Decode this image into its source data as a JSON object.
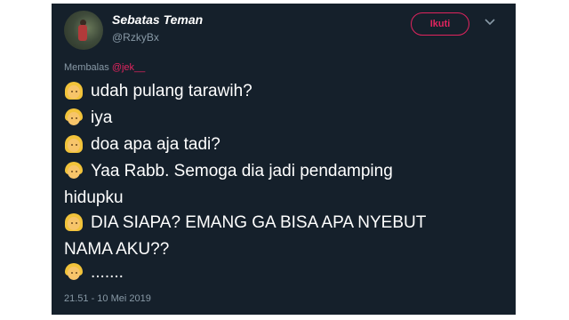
{
  "tweet": {
    "display_name": "Sebatas Teman",
    "handle": "@RzkyBx",
    "follow_label": "Ikuti",
    "reply_prefix": "Membalas",
    "reply_mention": "@jek__",
    "lines": [
      {
        "emoji": "girl-emoji",
        "text": "udah pulang tarawih?"
      },
      {
        "emoji": "boy-emoji",
        "text": "iya"
      },
      {
        "emoji": "girl-emoji",
        "text": "doa apa aja tadi?"
      },
      {
        "emoji": "boy-emoji",
        "text": "Yaa Rabb. Semoga dia jadi pendamping"
      },
      {
        "emoji": "girl-emoji",
        "text": "DIA SIAPA? EMANG GA BISA APA NYEBUT"
      },
      {
        "emoji": "boy-emoji",
        "text": "......."
      }
    ],
    "continuations": [
      "hidupku",
      "NAMA AKU??"
    ],
    "timestamp": "21.51 - 10 Mei 2019"
  },
  "colors": {
    "background": "#15202b",
    "accent": "#e0245e",
    "muted": "#8899a6"
  }
}
